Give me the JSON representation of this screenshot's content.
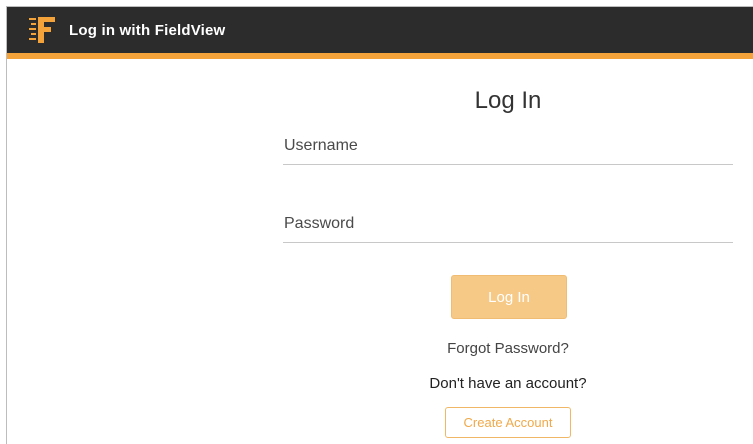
{
  "header": {
    "title": "Log in with FieldView",
    "logo_icon": "fieldview-logo-icon",
    "background_color": "#2c2c2c",
    "accent_color": "#f3a33a"
  },
  "form": {
    "heading": "Log In",
    "username": {
      "value": "",
      "placeholder": "Username"
    },
    "password": {
      "value": "",
      "placeholder": "Password"
    },
    "login_label": "Log In",
    "forgot_label": "Forgot Password?",
    "no_account_text": "Don't have an account?",
    "create_label": "Create Account",
    "button_color": "#f6c987"
  }
}
